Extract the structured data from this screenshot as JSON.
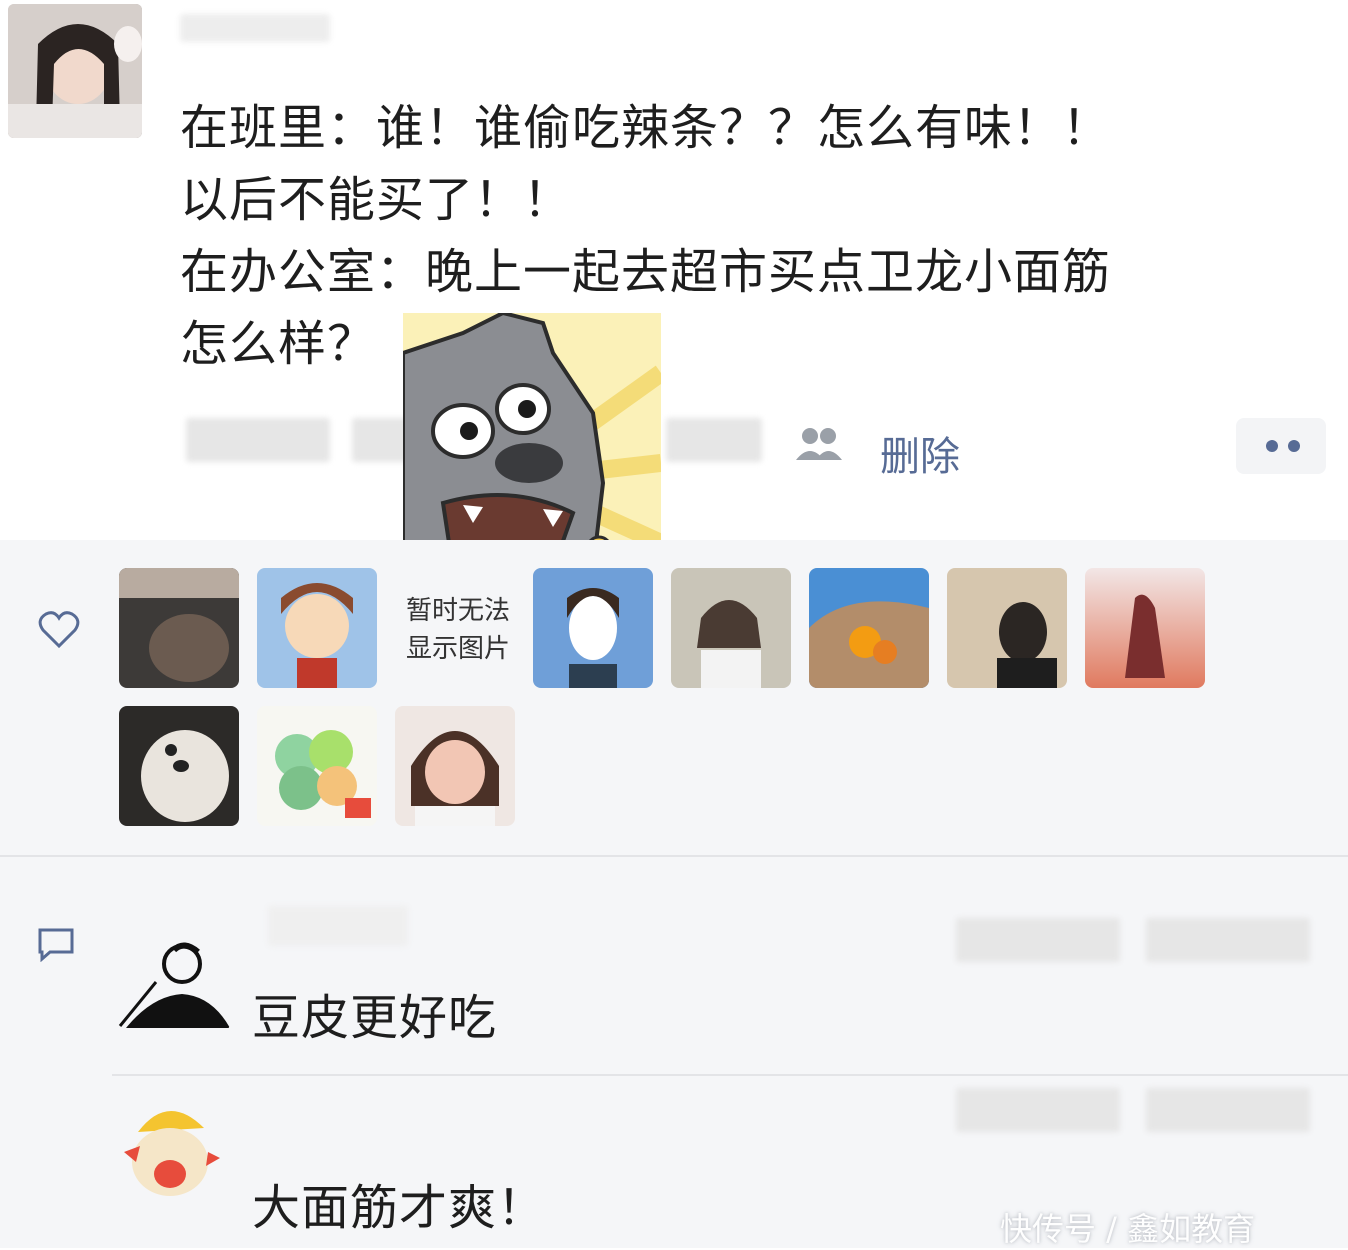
{
  "post": {
    "text": "在班里：谁！谁偷吃辣条？？怎么有味！！\n以后不能买了！！\n在办公室：晚上一起去超市买点卫龙小面筋\n怎么样？",
    "delete_label": "删除"
  },
  "likes": {
    "placeholder_text": "暂时无法显示图片"
  },
  "comments": [
    {
      "text": "豆皮更好吃"
    },
    {
      "text": "大面筋才爽！"
    }
  ],
  "watermark": "快传号 / 鑫如教育",
  "colors": {
    "link": "#576b95",
    "background_interactions": "#f5f6f8",
    "text": "#1e1e1e"
  },
  "icons": [
    "people-icon",
    "more-icon",
    "heart-icon",
    "comment-icon"
  ]
}
